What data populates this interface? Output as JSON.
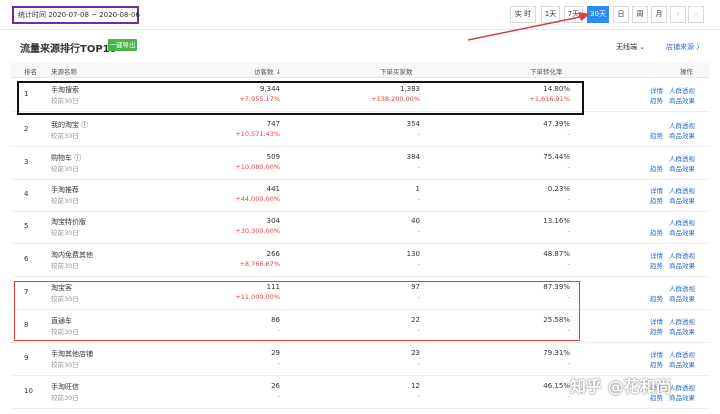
{
  "daterange": "统计时间 2020-07-08 ~ 2020-08-06",
  "segments": [
    "实 时",
    "1天",
    "7天",
    "30天",
    "日",
    "周",
    "月",
    "‹",
    "›"
  ],
  "title": "流量来源排行TOP10",
  "export_label": "一键导出",
  "wireless": "无线端 ⌄",
  "shop_source": "店铺来源 〉",
  "columns": {
    "rank": "排名",
    "source": "来源名称",
    "visitors": "访客数 ↓",
    "buyers": "下单买家数",
    "conv": "下单转化率",
    "op": "操作"
  },
  "rows": [
    {
      "rank": "1",
      "source": "手淘搜索",
      "sub": "较前30日",
      "visitors": "9,344",
      "visitors_chg": "+7,955.17%",
      "buyers": "1,383",
      "buyers_chg": "+138,200.00%",
      "conv": "14.80%",
      "conv_chg": "+1,616.91%",
      "op1": "详情",
      "op2": "人群透视",
      "op3": "趋势",
      "op4": "商品效果"
    },
    {
      "rank": "2",
      "source": "我的淘宝 ⓘ",
      "sub": "较前30日",
      "visitors": "747",
      "visitors_chg": "+10,571.43%",
      "buyers": "354",
      "buyers_chg": "-",
      "conv": "47.39%",
      "conv_chg": "-",
      "op1": "",
      "op2": "人群透视",
      "op3": "趋势",
      "op4": "商品效果"
    },
    {
      "rank": "3",
      "source": "购物车 ⓘ",
      "sub": "较前30日",
      "visitors": "509",
      "visitors_chg": "+10,080.00%",
      "buyers": "384",
      "buyers_chg": "-",
      "conv": "75.44%",
      "conv_chg": "-",
      "op1": "",
      "op2": "人群透视",
      "op3": "趋势",
      "op4": "商品效果"
    },
    {
      "rank": "4",
      "source": "手淘推荐",
      "sub": "较前30日",
      "visitors": "441",
      "visitors_chg": "+44,000.00%",
      "buyers": "1",
      "buyers_chg": "-",
      "conv": "0.23%",
      "conv_chg": "-",
      "op1": "详情",
      "op2": "人群透视",
      "op3": "趋势",
      "op4": "商品效果"
    },
    {
      "rank": "5",
      "source": "淘宝特价版",
      "sub": "较前30日",
      "visitors": "304",
      "visitors_chg": "+30,300.00%",
      "buyers": "40",
      "buyers_chg": "-",
      "conv": "13.16%",
      "conv_chg": "-",
      "op1": "",
      "op2": "人群透视",
      "op3": "趋势",
      "op4": "商品效果"
    },
    {
      "rank": "6",
      "source": "淘内免费其他",
      "sub": "较前30日",
      "visitors": "266",
      "visitors_chg": "+8,766.67%",
      "buyers": "130",
      "buyers_chg": "-",
      "conv": "48.87%",
      "conv_chg": "-",
      "op1": "详情",
      "op2": "人群透视",
      "op3": "趋势",
      "op4": "商品效果"
    },
    {
      "rank": "7",
      "source": "淘宝客",
      "sub": "较前30日",
      "visitors": "111",
      "visitors_chg": "+11,000.00%",
      "buyers": "97",
      "buyers_chg": "-",
      "conv": "87.39%",
      "conv_chg": "-",
      "op1": "",
      "op2": "人群透视",
      "op3": "趋势",
      "op4": "商品效果"
    },
    {
      "rank": "8",
      "source": "直通车",
      "sub": "较前30日",
      "visitors": "86",
      "visitors_chg": "-",
      "buyers": "22",
      "buyers_chg": "-",
      "conv": "25.58%",
      "conv_chg": "-",
      "op1": "详情",
      "op2": "人群透视",
      "op3": "趋势",
      "op4": "商品效果"
    },
    {
      "rank": "9",
      "source": "手淘其他店铺",
      "sub": "较前30日",
      "visitors": "29",
      "visitors_chg": "-",
      "buyers": "23",
      "buyers_chg": "-",
      "conv": "79.31%",
      "conv_chg": "-",
      "op1": "详情",
      "op2": "人群透视",
      "op3": "趋势",
      "op4": "商品效果"
    },
    {
      "rank": "10",
      "source": "手淘旺信",
      "sub": "较前30日",
      "visitors": "26",
      "visitors_chg": "-",
      "buyers": "12",
      "buyers_chg": "-",
      "conv": "46.15%",
      "conv_chg": "-",
      "op1": "详情",
      "op2": "人群透视",
      "op3": "趋势",
      "op4": "商品效果"
    }
  ],
  "watermark": "知乎 @花和尚",
  "colors": {
    "active": "#2d8cf0",
    "increase": "#e54545",
    "link": "#2d6ec8",
    "export": "#45b649",
    "annotation_red": "#d94040",
    "annotation_purple": "#6b2fa0"
  }
}
